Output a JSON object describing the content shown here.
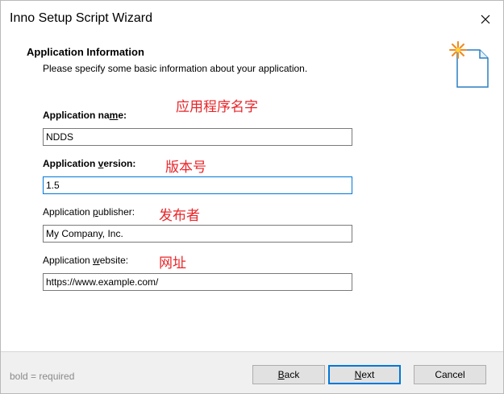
{
  "window": {
    "title": "Inno Setup Script Wizard"
  },
  "header": {
    "title": "Application Information",
    "description": "Please specify some basic information about your application."
  },
  "fields": {
    "name": {
      "label_pre": "Application na",
      "label_ul": "m",
      "label_post": "e:",
      "value": "NDDS",
      "annotation": "应用程序名字"
    },
    "version": {
      "label_pre": "Application ",
      "label_ul": "v",
      "label_post": "ersion:",
      "value": "1.5",
      "annotation": "版本号"
    },
    "publisher": {
      "label_pre": "Application ",
      "label_ul": "p",
      "label_post": "ublisher:",
      "value": "My Company, Inc.",
      "annotation": "发布者"
    },
    "website": {
      "label_pre": "Application ",
      "label_ul": "w",
      "label_post": "ebsite:",
      "value": "https://www.example.com/",
      "annotation": "网址"
    }
  },
  "footer": {
    "legend_bold": "bold",
    "legend_rest": " = required",
    "back": {
      "ul": "B",
      "rest": "ack"
    },
    "next": {
      "ul": "N",
      "rest": "ext"
    },
    "cancel": "Cancel"
  },
  "colors": {
    "annotation": "#e8262a",
    "focus": "#0078d7",
    "footer_bg": "#f0f0f0"
  }
}
